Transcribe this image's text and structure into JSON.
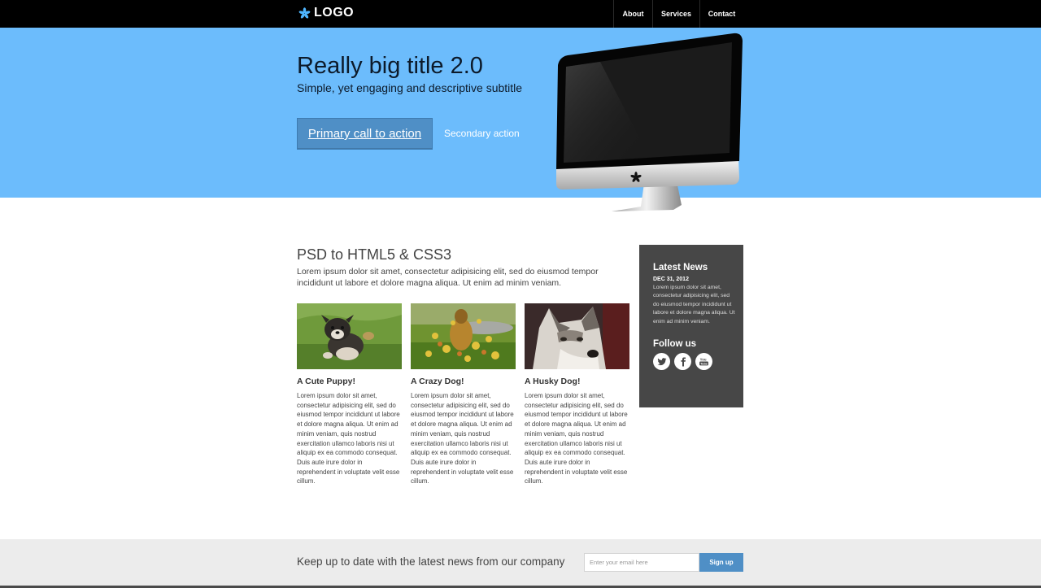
{
  "header": {
    "logo_text": "LOGO",
    "nav": [
      "About",
      "Services",
      "Contact"
    ]
  },
  "hero": {
    "title": "Really big title 2.0",
    "subtitle": "Simple, yet engaging and descriptive subtitle",
    "primary_cta": "Primary call to action",
    "secondary_cta": "Secondary action",
    "background_color": "#6cbcfc"
  },
  "main": {
    "title": "PSD to HTML5 & CSS3",
    "intro": "Lorem ipsum dolor sit amet, consectetur adipisicing elit, sed do eiusmod tempor incididunt ut labore et dolore magna aliqua. Ut enim ad minim veniam.",
    "cards": [
      {
        "title": "A Cute Puppy!",
        "text": "Lorem ipsum dolor sit amet, consectetur adipisicing elit, sed do eiusmod tempor incididunt ut labore et dolore magna aliqua. Ut enim ad minim veniam, quis nostrud exercitation ullamco laboris nisi ut aliquip ex ea commodo consequat. Duis aute irure dolor in reprehendent in voluptate velit esse cillum."
      },
      {
        "title": "A Crazy Dog!",
        "text": "Lorem ipsum dolor sit amet, consectetur adipisicing elit, sed do eiusmod tempor incididunt ut labore et dolore magna aliqua. Ut enim ad minim veniam, quis nostrud exercitation ullamco laboris nisi ut aliquip ex ea commodo consequat. Duis aute irure dolor in reprehendent in voluptate velit esse cillum."
      },
      {
        "title": "A Husky Dog!",
        "text": "Lorem ipsum dolor sit amet, consectetur adipisicing elit, sed do eiusmod tempor incididunt ut labore et dolore magna aliqua. Ut enim ad minim veniam, quis nostrud exercitation ullamco laboris nisi ut aliquip ex ea commodo consequat. Duis aute irure dolor in reprehendent in voluptate velit esse cillum."
      }
    ]
  },
  "sidebar": {
    "news_title": "Latest News",
    "news_date": "DEC 31, 2012",
    "news_text": "Lorem ipsum dolor sit amet, consectetur adipisicing elit, sed do eiusmod tempor incididunt ut labore et dolore magna aliqua. Ut enim ad minim veniam.",
    "follow_title": "Follow us",
    "social_icons": [
      "twitter-icon",
      "facebook-icon",
      "youtube-icon"
    ]
  },
  "footer": {
    "text": "Keep up to date with the latest news from our company",
    "email_placeholder": "Enter your email here",
    "signup_label": "Sign up",
    "accent_color": "#4f8fc6"
  }
}
